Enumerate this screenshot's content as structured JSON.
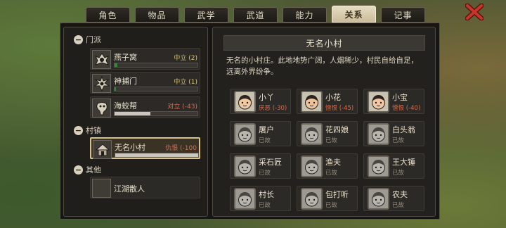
{
  "tabs": [
    {
      "label": "角色",
      "active": false
    },
    {
      "label": "物品",
      "active": false
    },
    {
      "label": "武学",
      "active": false
    },
    {
      "label": "武道",
      "active": false
    },
    {
      "label": "能力",
      "active": false
    },
    {
      "label": "关系",
      "active": true
    },
    {
      "label": "记事",
      "active": false
    }
  ],
  "colors": {
    "accent": "#d8c08a",
    "neutral": "#e2c46a",
    "hostile": "#d96a4e",
    "bar_green": "#2e8a3a",
    "close_red": "#c9342a"
  },
  "groups": [
    {
      "label": "门派",
      "items": [
        {
          "name": "燕子窝",
          "relation": "中立 (2)",
          "tone": "neutral",
          "level": 0.02,
          "icon": "sect-emblem-icon"
        },
        {
          "name": "神捕门",
          "relation": "中立 (1)",
          "tone": "neutral",
          "level": 0.01,
          "icon": "sect-emblem-icon"
        },
        {
          "name": "海蛟帮",
          "relation": "对立 (-43)",
          "tone": "hostile",
          "level": 0.43,
          "icon": "sect-emblem-icon"
        }
      ]
    },
    {
      "label": "村镇",
      "items": [
        {
          "name": "无名小村",
          "relation": "仇恨 (-100",
          "tone": "hostile",
          "level": 1.0,
          "icon": "village-house-icon",
          "selected": true
        }
      ]
    },
    {
      "label": "其他",
      "items": [
        {
          "name": "江湖散人",
          "relation": "",
          "tone": "none",
          "icon": "blank-icon"
        }
      ]
    }
  ],
  "detail": {
    "title": "无名小村",
    "description": "无名的小村庄。此地地势广阔，人烟稀少，村民自给自足，远离外界纷争。"
  },
  "npcs": [
    {
      "name": "小丫",
      "status": "厌恶 (-30)",
      "alive": true
    },
    {
      "name": "小花",
      "status": "憎恨 (-45)",
      "alive": true
    },
    {
      "name": "小宝",
      "status": "憎恨 (-40)",
      "alive": true
    },
    {
      "name": "屠户",
      "status": "已故",
      "alive": false
    },
    {
      "name": "花四娘",
      "status": "已故",
      "alive": false
    },
    {
      "name": "白头翁",
      "status": "已故",
      "alive": false
    },
    {
      "name": "采石匠",
      "status": "已故",
      "alive": false
    },
    {
      "name": "渔夫",
      "status": "已故",
      "alive": false
    },
    {
      "name": "王大锤",
      "status": "已故",
      "alive": false
    },
    {
      "name": "村长",
      "status": "已故",
      "alive": false
    },
    {
      "name": "包打听",
      "status": "已故",
      "alive": false
    },
    {
      "name": "农夫",
      "status": "已故",
      "alive": false
    }
  ]
}
